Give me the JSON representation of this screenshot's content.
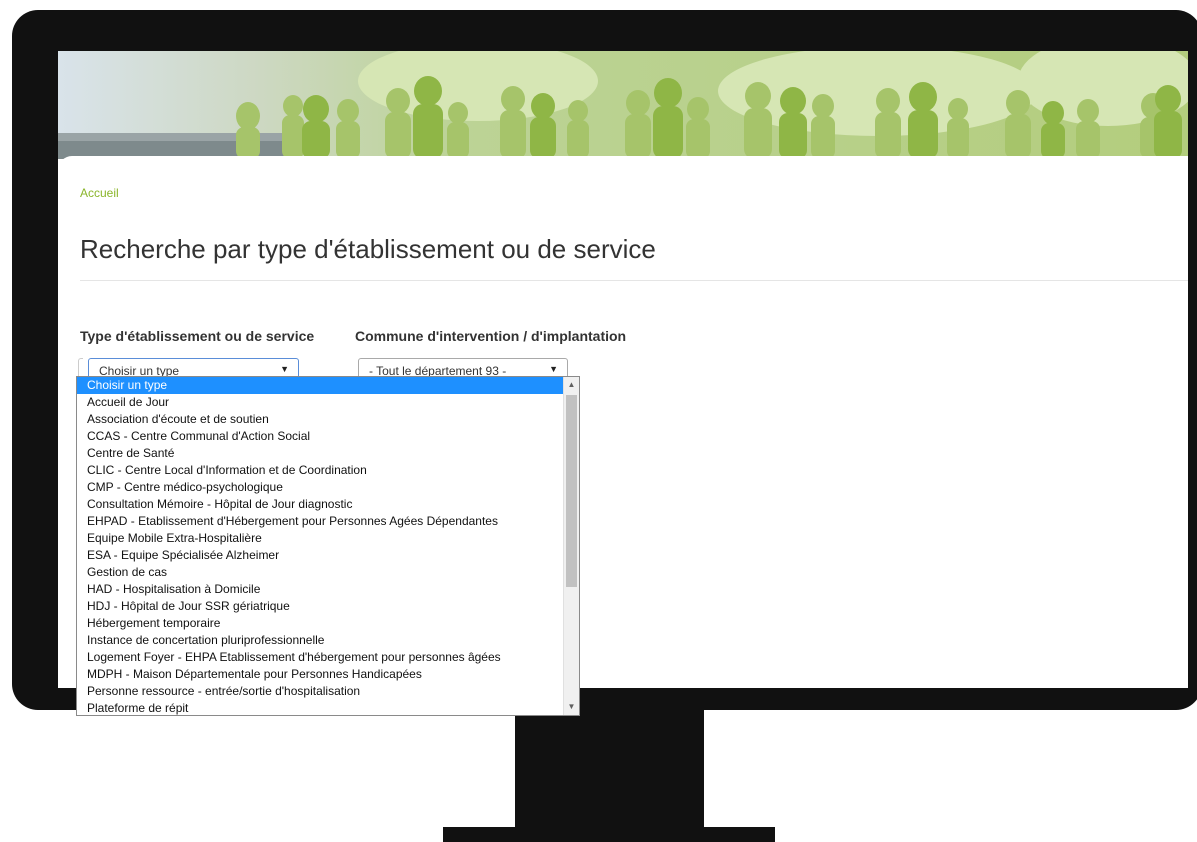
{
  "breadcrumb": "Accueil",
  "title": "Recherche par type d'établissement ou de service",
  "form": {
    "type_label": "Type d'établissement ou de service",
    "commune_label": "Commune d'intervention / d'implantation",
    "type_value": "Choisir un type",
    "commune_value": "- Tout le département 93 -"
  },
  "dropdown": {
    "selected_index": 0,
    "options": [
      "Choisir un type",
      "Accueil de Jour",
      "Association d'écoute et de soutien",
      "CCAS - Centre Communal d'Action Social",
      "Centre de Santé",
      "CLIC - Centre Local d'Information et de Coordination",
      "CMP - Centre médico-psychologique",
      "Consultation Mémoire - Hôpital de Jour diagnostic",
      "EHPAD - Etablissement d'Hébergement pour Personnes Agées Dépendantes",
      "Equipe Mobile Extra-Hospitalière",
      "ESA - Equipe Spécialisée Alzheimer",
      "Gestion de cas",
      "HAD - Hospitalisation à Domicile",
      "HDJ - Hôpital de Jour SSR gériatrique",
      "Hébergement temporaire",
      "Instance de concertation pluriprofessionnelle",
      "Logement Foyer - EHPA Etablissement d'hébergement pour personnes âgées",
      "MDPH - Maison Départementale pour Personnes Handicapées",
      "Personne ressource - entrée/sortie d'hospitalisation",
      "Plateforme de répit"
    ]
  },
  "icons": {
    "select_arrow": "caret-down-icon",
    "scroll_up": "scroll-up-icon",
    "scroll_down": "scroll-down-icon"
  },
  "colors": {
    "accent_green": "#8ab52a",
    "banner_green": "#b7cf88",
    "selection_blue": "#1e90ff"
  }
}
